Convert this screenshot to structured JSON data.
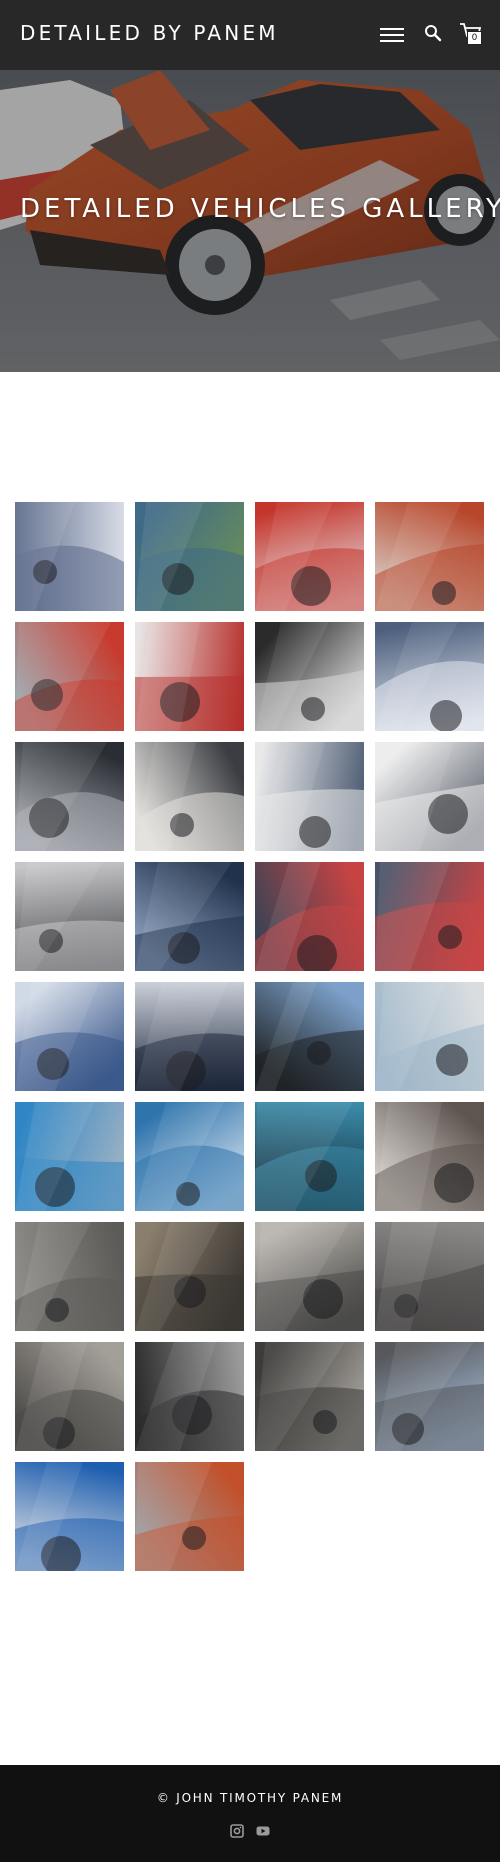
{
  "header": {
    "site_title": "DETAILED BY PANEM",
    "cart_count": "0",
    "icons": [
      "menu-icon",
      "search-icon",
      "cart-icon"
    ]
  },
  "hero": {
    "title": "DETAILED VEHICLES GALLERY"
  },
  "gallery": {
    "photos": [
      {
        "subject": "engine bay with foam",
        "colors": [
          "#5b6a8a",
          "#d8dce6"
        ]
      },
      {
        "subject": "blue hatchback",
        "colors": [
          "#3e6a86",
          "#6b8f5a"
        ]
      },
      {
        "subject": "red sedan front",
        "colors": [
          "#c4352b",
          "#e6e6ea"
        ]
      },
      {
        "subject": "orange fender",
        "colors": [
          "#b8462a",
          "#d9d4ce"
        ]
      },
      {
        "subject": "red sedan",
        "colors": [
          "#c83a2e",
          "#9da3a9"
        ]
      },
      {
        "subject": "foamed red car",
        "colors": [
          "#b7322e",
          "#e8e4e4"
        ]
      },
      {
        "subject": "white sports car foamed",
        "colors": [
          "#d9d9d9",
          "#2a2a2a"
        ]
      },
      {
        "subject": "white car reflection",
        "colors": [
          "#e1e6ee",
          "#4d5f7d"
        ]
      },
      {
        "subject": "silver sedan",
        "colors": [
          "#a9acb2",
          "#2a2d33"
        ]
      },
      {
        "subject": "white panel",
        "colors": [
          "#e2e0dc",
          "#3b3d42"
        ]
      },
      {
        "subject": "white car upside",
        "colors": [
          "#e9e9ea",
          "#4e5d73"
        ]
      },
      {
        "subject": "white car rear",
        "colors": [
          "#ececec",
          "#5f6570"
        ]
      },
      {
        "subject": "foamed coupe",
        "colors": [
          "#c7c7c9",
          "#3e3f44"
        ]
      },
      {
        "subject": "dark blue paint",
        "colors": [
          "#20324c",
          "#8fa3c1"
        ]
      },
      {
        "subject": "red tail lights",
        "colors": [
          "#c74343",
          "#3b4354"
        ]
      },
      {
        "subject": "red tail lights 2",
        "colors": [
          "#c94545",
          "#4a5266"
        ]
      },
      {
        "subject": "blue panel reflection",
        "colors": [
          "#3c5a8c",
          "#d1d9e6"
        ]
      },
      {
        "subject": "dark blue door",
        "colors": [
          "#1d273a",
          "#c9ced8"
        ]
      },
      {
        "subject": "dark sports car",
        "colors": [
          "#1f2326",
          "#7ca0c9"
        ]
      },
      {
        "subject": "light blue car foam",
        "colors": [
          "#9fb7c9",
          "#d9dde0"
        ]
      },
      {
        "subject": "blue hatchback street",
        "colors": [
          "#2f86c5",
          "#9cb1c4"
        ]
      },
      {
        "subject": "blue glossy panel",
        "colors": [
          "#2e74ad",
          "#d4e0ec"
        ]
      },
      {
        "subject": "teal hood",
        "colors": [
          "#3b8aa8",
          "#0f2430"
        ]
      },
      {
        "subject": "brown underbody",
        "colors": [
          "#5e5550",
          "#d7d2cd"
        ]
      },
      {
        "subject": "grey body panel",
        "colors": [
          "#5d5b58",
          "#8f8d89"
        ]
      },
      {
        "subject": "dirty wheel",
        "colors": [
          "#3a3632",
          "#8a7e6c"
        ]
      },
      {
        "subject": "grey fender",
        "colors": [
          "#4b4a48",
          "#b7b3ad"
        ]
      },
      {
        "subject": "grey door lettering",
        "colors": [
          "#4a4948",
          "#898785"
        ]
      },
      {
        "subject": "grey fender wheel",
        "colors": [
          "#4d4b48",
          "#a29e98"
        ]
      },
      {
        "subject": "engine bay",
        "colors": [
          "#2b2b2b",
          "#9a9a9a"
        ]
      },
      {
        "subject": "clean wheel",
        "colors": [
          "#3d3c3a",
          "#a7a39d"
        ]
      },
      {
        "subject": "grey panel reflection",
        "colors": [
          "#56585c",
          "#a9c1dc"
        ]
      },
      {
        "subject": "blue race car",
        "colors": [
          "#1f5fb0",
          "#e5e5e5"
        ]
      },
      {
        "subject": "orange race car",
        "colors": [
          "#c2512b",
          "#9a9da2"
        ]
      }
    ]
  },
  "footer": {
    "copyright": "© JOHN TIMOTHY PANEM",
    "social": [
      "instagram-icon",
      "youtube-icon"
    ]
  }
}
